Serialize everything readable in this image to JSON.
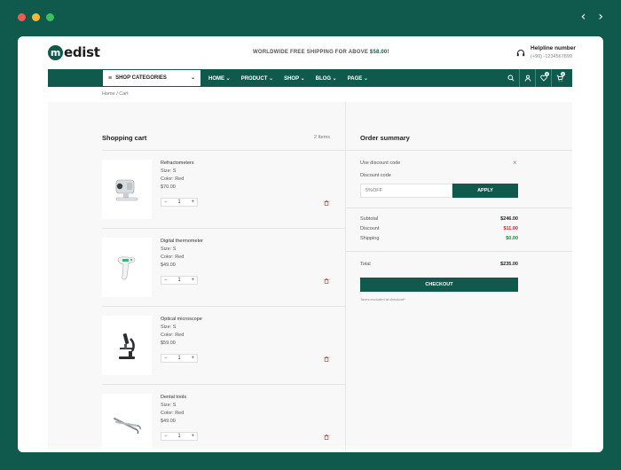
{
  "window": {
    "controls": [
      "close",
      "minimize",
      "maximize"
    ],
    "nav_back": "‹",
    "nav_forward": "›"
  },
  "header": {
    "logo_letter": "m",
    "logo_text": "edist",
    "shipping_text": "WORLDWIDE FREE SHIPPING FOR ABOVE ",
    "shipping_amount": "$58.00!",
    "helpline_title": "Helpline number",
    "helpline_phone": "(+90) -1234567899"
  },
  "nav": {
    "categories_label": "SHOP CATEGORIES",
    "menu": [
      "HOME ⌄",
      "PRODUCT ⌄",
      "SHOP ⌄",
      "BLOG ⌄",
      "PAGE ⌄"
    ],
    "wishlist_count": "0",
    "cart_count": "0"
  },
  "breadcrumb": "Home / Cart",
  "cart": {
    "title": "Shopping cart",
    "count": "2 Items",
    "items": [
      {
        "name": "Refractometers",
        "size": "Size: S",
        "color": "Color: Red",
        "price": "$70.00",
        "qty": "1",
        "icon": "refractometer-icon"
      },
      {
        "name": "Digital thermometer",
        "size": "Size: S",
        "color": "Color: Red",
        "price": "$49.00",
        "qty": "1",
        "icon": "thermometer-icon"
      },
      {
        "name": "Optical microscope",
        "size": "Size: S",
        "color": "Color: Red",
        "price": "$59.00",
        "qty": "1",
        "icon": "microscope-icon"
      },
      {
        "name": "Dental tools",
        "size": "Size: S",
        "color": "Color: Red",
        "price": "$49.00",
        "qty": "1",
        "icon": "dental-tools-icon"
      }
    ],
    "minus": "−",
    "plus": "+"
  },
  "summary": {
    "title": "Order summary",
    "discount_toggle": "Use discount code",
    "close": "×",
    "code_label": "Discount code",
    "code_value": "5%OFF",
    "apply_label": "APPLY",
    "subtotal_label": "Subtotal",
    "subtotal_value": "$246.00",
    "discount_label": "Discount",
    "discount_value": "$11.00",
    "shipping_label": "Shipping",
    "shipping_value": "$0.00",
    "total_label": "Total",
    "total_value": "$235.00",
    "checkout_label": "CHECKOUT",
    "tax_note": "Taxes excluded at checkout*"
  },
  "colors": {
    "brand": "#0f5a4d",
    "discount": "#dd2222",
    "shipping": "#1a8a3a"
  }
}
